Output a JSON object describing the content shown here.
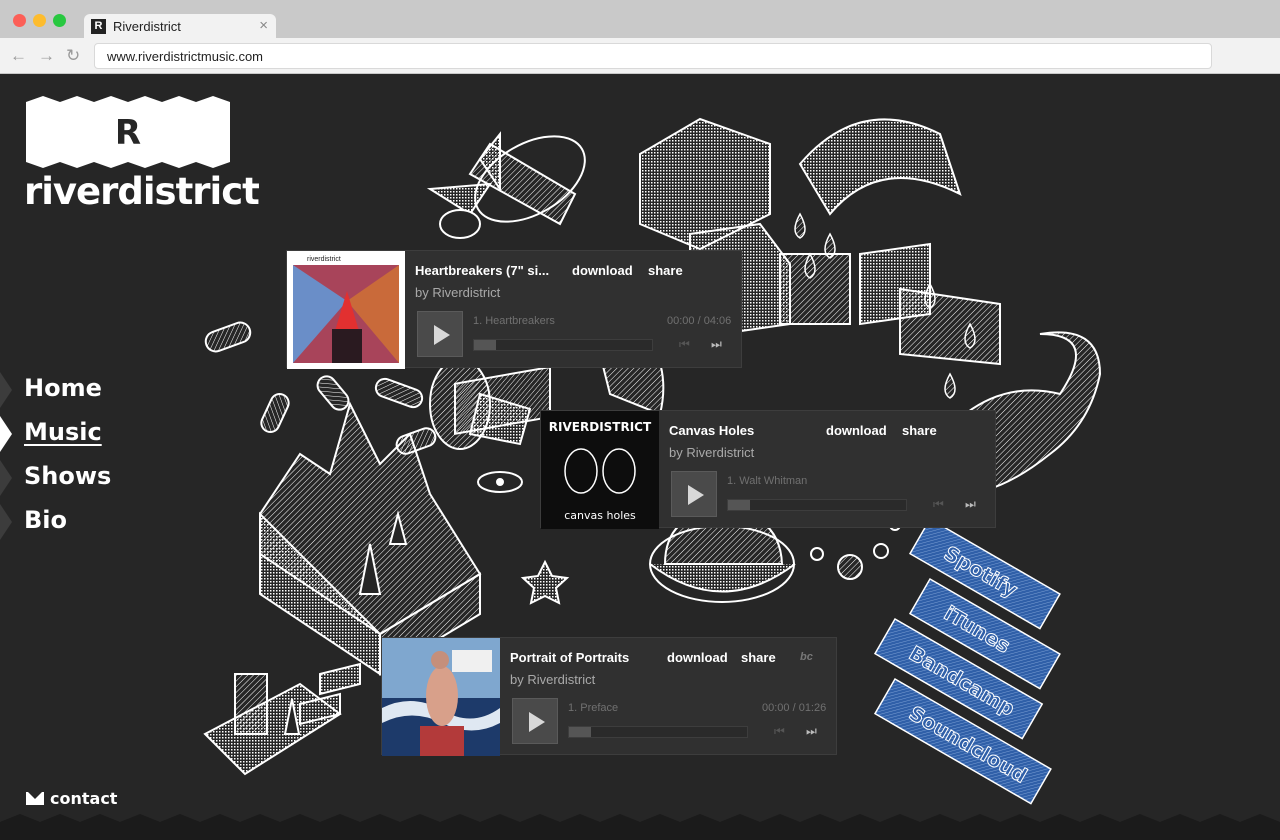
{
  "browser": {
    "tab_title": "Riverdistrict",
    "favicon_letter": "R",
    "url": "www.riverdistrictmusic.com",
    "close_glyph": "×"
  },
  "site": {
    "logo_letter": "R",
    "logo_word": "riverdistrict",
    "nav": [
      {
        "label": "Home",
        "active": false
      },
      {
        "label": "Music",
        "active": true
      },
      {
        "label": "Shows",
        "active": false
      },
      {
        "label": "Bio",
        "active": false
      }
    ],
    "contact_label": "contact",
    "players": [
      {
        "title": "Heartbreakers (7\" si...",
        "download": "download",
        "share": "share",
        "by": "by Riverdistrict",
        "track": "1.  Heartbreakers",
        "time": "00:00 / 04:06",
        "cover_label": "riverdistrict"
      },
      {
        "title": "Canvas Holes",
        "download": "download",
        "share": "share",
        "by": "by Riverdistrict",
        "track": "1.  Walt Whitman",
        "cover_label": "RIVERDISTRICT",
        "cover_sub": "canvas holes"
      },
      {
        "title": "Portrait of Portraits",
        "download": "download",
        "share": "share",
        "by": "by Riverdistrict",
        "track": "1.  Preface",
        "time": "00:00 / 01:26",
        "bc_logo": "bc"
      }
    ],
    "services": [
      "Spotify",
      "iTunes",
      "Bandcamp",
      "Soundcloud"
    ],
    "accent_blue": "#2f5fa8"
  }
}
